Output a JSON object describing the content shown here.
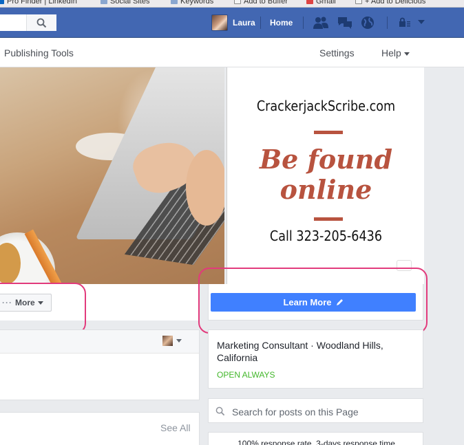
{
  "browser": {
    "bookmarks": [
      "Pro Finder | LinkedIn",
      "Social Sites",
      "Keywords",
      "Add to Buffer",
      "Gmail",
      "+ Add to Delicious"
    ]
  },
  "topbar": {
    "profile_name": "Laura",
    "home_label": "Home",
    "colors": {
      "background": "#4267b2"
    }
  },
  "page_nav": {
    "publishing_tools": "Publishing Tools",
    "settings": "Settings",
    "help": "Help"
  },
  "promo": {
    "site": "CrackerjackScribe.com",
    "tagline_line1": "Be found",
    "tagline_line2": "online",
    "phone": "Call 323-205-6436",
    "accent_color": "#b8533f"
  },
  "actions": {
    "more_label": "More",
    "learn_more_label": "Learn More",
    "learn_more_color": "#4080ff"
  },
  "about": {
    "category_location": "Marketing Consultant · Woodland Hills, California",
    "hours": "OPEN ALWAYS"
  },
  "search_posts": {
    "placeholder": "Search for posts on this Page"
  },
  "response": {
    "text": "100% response rate, 3-days response time"
  },
  "photos_card": {
    "see_all": "See All"
  },
  "highlight_color": "#e23a7c"
}
